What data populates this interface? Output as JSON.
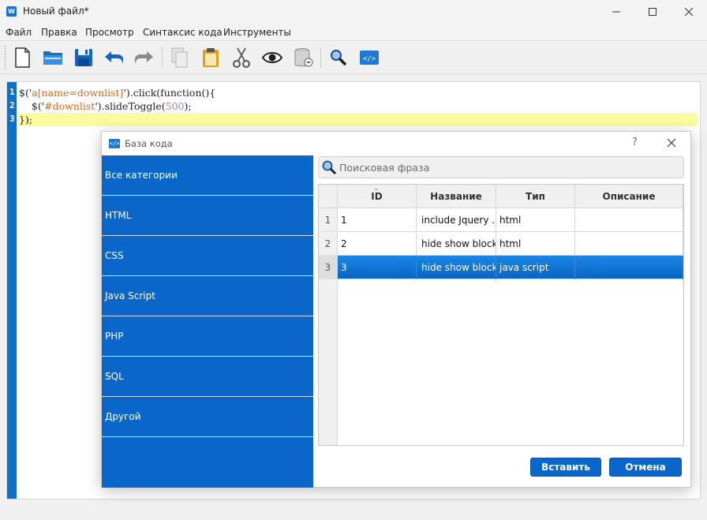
{
  "window": {
    "title": "Новый файл*",
    "app_icon": "W"
  },
  "menu": [
    "Файл",
    "Правка",
    "Просмотр",
    "Синтаксис кода",
    "Инструменты"
  ],
  "toolbar": {
    "icons": [
      "new-file-icon",
      "open-folder-icon",
      "save-icon",
      "undo-icon",
      "redo-icon",
      "copy-icon",
      "paste-icon",
      "cut-icon",
      "preview-eye-icon",
      "database-icon",
      "search-icon",
      "code-snippet-icon"
    ]
  },
  "editor": {
    "line_numbers": [
      "1",
      "2",
      "3"
    ],
    "lines": [
      {
        "a": "$('",
        "b": "a[name=downlist]",
        "c": "').click(function(){",
        "d": "",
        "e": ""
      },
      {
        "a": "    $('",
        "b": "#downlist",
        "c": "').slideToggle(",
        "d": "500",
        "e": ");"
      },
      {
        "a": "});",
        "b": "",
        "c": "",
        "d": "",
        "e": ""
      }
    ],
    "colors": {
      "string": "#d2691e",
      "number": "#a37fd4",
      "active_line": "#fafa9e",
      "gutter": "#0f6fc4"
    }
  },
  "dialog": {
    "title": "База кода",
    "help": "?",
    "categories": [
      "Все категории",
      "HTML",
      "CSS",
      "Java Script",
      "PHP",
      "SQL",
      "Другой"
    ],
    "search_placeholder": "Поисковая фраза",
    "columns": [
      "ID",
      "Название",
      "Тип",
      "Описание"
    ],
    "rows": [
      {
        "num": "1",
        "id": "1",
        "name": "include Jquery ...",
        "type": "html",
        "desc": ""
      },
      {
        "num": "2",
        "id": "2",
        "name": "hide show block",
        "type": "html",
        "desc": ""
      },
      {
        "num": "3",
        "id": "3",
        "name": "hide show block",
        "type": "java script",
        "desc": ""
      }
    ],
    "selected_row": 3,
    "insert_label": "Вставить",
    "cancel_label": "Отмена",
    "accent_color": "#0a66c8"
  }
}
